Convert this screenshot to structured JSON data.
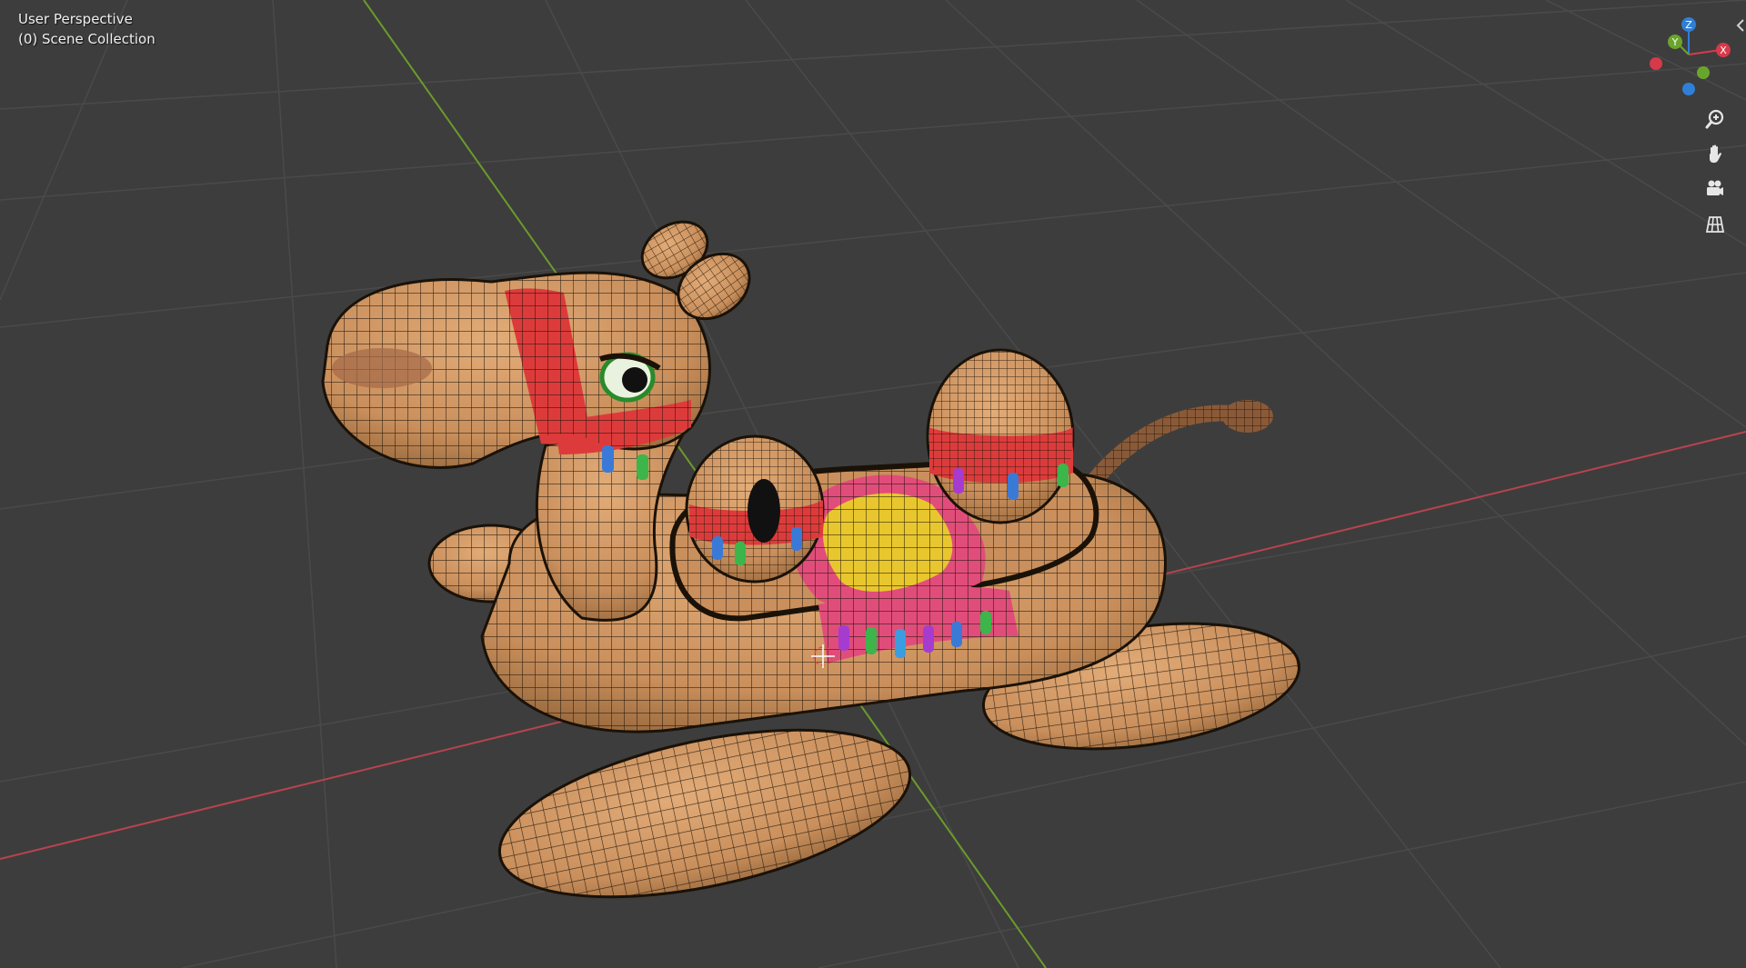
{
  "viewport": {
    "view_label": "User Perspective",
    "collection_label": "(0) Scene Collection",
    "background_color": "#3d3d3d",
    "grid_color": "#4a4a4a",
    "x_axis_color": "#b8434f",
    "y_axis_color": "#6b9a2c"
  },
  "gizmo": {
    "z_label": "Z",
    "y_label": "Y",
    "x_label": "X",
    "z_color": "#2f7fd6",
    "y_color": "#6aa52b",
    "x_color": "#d63a4a"
  },
  "navigation": {
    "zoom_icon": "zoom-icon",
    "pan_icon": "hand-icon",
    "camera_icon": "camera-icon",
    "ortho_icon": "grid-perspective-icon"
  },
  "model": {
    "object": "inflatable-camel",
    "body_color": "#c98f5c",
    "stripe_color": "#dd3b3b",
    "saddle_color": "#e8c72e",
    "wire_color": "#1a1208"
  }
}
